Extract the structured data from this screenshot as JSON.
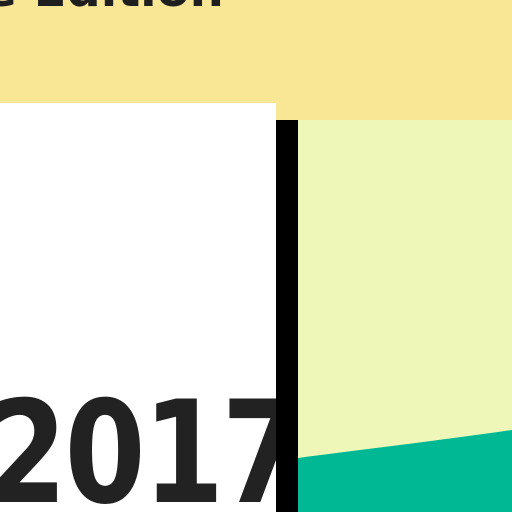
{
  "banner": {
    "title": "ge Edition",
    "background_color": "#fae795"
  },
  "card": {
    "year": "2017",
    "background_color": "#ffffff",
    "text_color": "#222222"
  },
  "divider": {
    "color": "#000000"
  },
  "graphic_panel": {
    "background_color": "#eef7b7",
    "wave_color": "#00b894"
  }
}
